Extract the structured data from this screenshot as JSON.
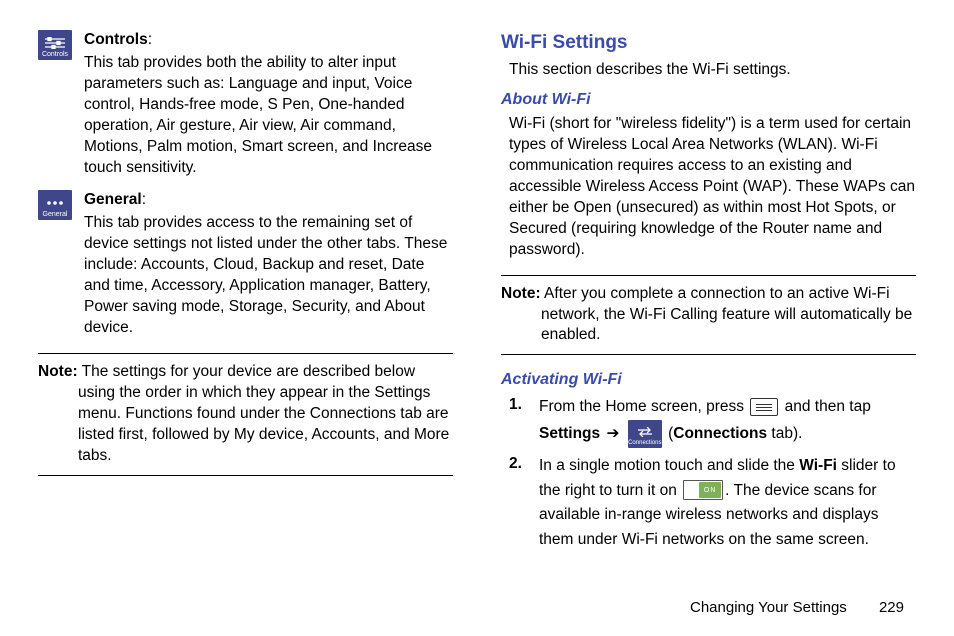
{
  "leftColumn": {
    "controlsTab": {
      "iconLabel": "Controls",
      "title": "Controls",
      "colon": ":",
      "desc": "This tab provides both the ability to alter input parameters such as: Language and input, Voice control, Hands-free mode, S Pen, One-handed operation, Air gesture, Air view, Air command, Motions, Palm motion, Smart screen, and Increase touch sensitivity."
    },
    "generalTab": {
      "iconLabel": "General",
      "title": "General",
      "colon": ":",
      "desc": "This tab provides access to the remaining set of device settings not listed under the other tabs. These include: Accounts, Cloud, Backup and reset, Date and time, Accessory, Application manager, Battery, Power saving mode, Storage, Security, and About device."
    },
    "note": {
      "label": "Note:",
      "text": " The settings for your device are described below using the order in which they appear in the Settings menu. Functions found under the Connections tab are listed first, followed by My device, Accounts, and More tabs."
    }
  },
  "rightColumn": {
    "heading": "Wi-Fi Settings",
    "intro": "This section describes the Wi-Fi settings.",
    "aboutHead": "About Wi-Fi",
    "aboutPara": "Wi-Fi (short for \"wireless fidelity\") is a term used for certain types of Wireless Local Area Networks (WLAN). Wi-Fi communication requires access to an existing and accessible Wireless Access Point (WAP). These WAPs can either be Open (unsecured) as within most Hot Spots, or Secured (requiring knowledge of the Router name and password).",
    "note": {
      "label": "Note:",
      "text": " After you complete a connection to an active Wi-Fi network, the Wi-Fi Calling feature will automatically be enabled."
    },
    "activatingHead": "Activating Wi-Fi",
    "step1": {
      "num": "1.",
      "pre": "From the Home screen, press ",
      "mid": " and then tap ",
      "settings": "Settings",
      "arrow": "➔",
      "connIconLabel": "Connections",
      "openParen": " (",
      "connBold": "Connections",
      "tabText": " tab)."
    },
    "step2": {
      "num": "2.",
      "pre": "In a single motion touch and slide the ",
      "wifiBold": "Wi-Fi",
      "mid": " slider to the right to turn it on ",
      "toggleLabel": "ON",
      "post": ". The device scans for available in-range wireless networks and displays them under Wi-Fi networks on the same screen."
    }
  },
  "footer": {
    "chapter": "Changing Your Settings",
    "page": "229"
  }
}
